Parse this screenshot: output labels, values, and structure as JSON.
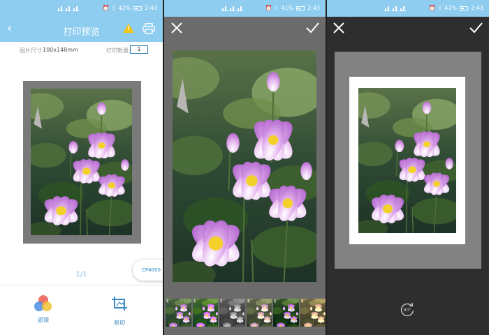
{
  "statusbar": {
    "p1": {
      "battery": "42%",
      "time": "2:43"
    },
    "p2": {
      "battery": "41%",
      "time": "2:43"
    },
    "p3": {
      "battery": "41%",
      "time": "2:43"
    }
  },
  "print_preview": {
    "title": "打印预览",
    "size_label": "图片尺寸:",
    "size_value": "100x148mm",
    "qty_label": "打印数量:",
    "qty_value": "1",
    "page_indicator": "1/1",
    "printer_name": "CP4000",
    "filter_label": "滤镜",
    "crop_label": "剪切",
    "icons": [
      "back-icon",
      "warning-icon",
      "printer-icon",
      "filter-icon",
      "crop-icon"
    ]
  },
  "filter_editor": {
    "icons": [
      "close-icon",
      "check-icon"
    ],
    "filters": [
      "original",
      "vivid",
      "mono",
      "warm",
      "film",
      "golden"
    ]
  },
  "crop_editor": {
    "icons": [
      "close-icon",
      "check-icon"
    ],
    "rotate_label": "90°"
  },
  "colors": {
    "statusbar": "#8ecdf0",
    "accent": "#3a8ac6",
    "warning": "#f5c518",
    "editor_gray": "#6b6b6b",
    "editor_dark": "#2e2e2e"
  }
}
